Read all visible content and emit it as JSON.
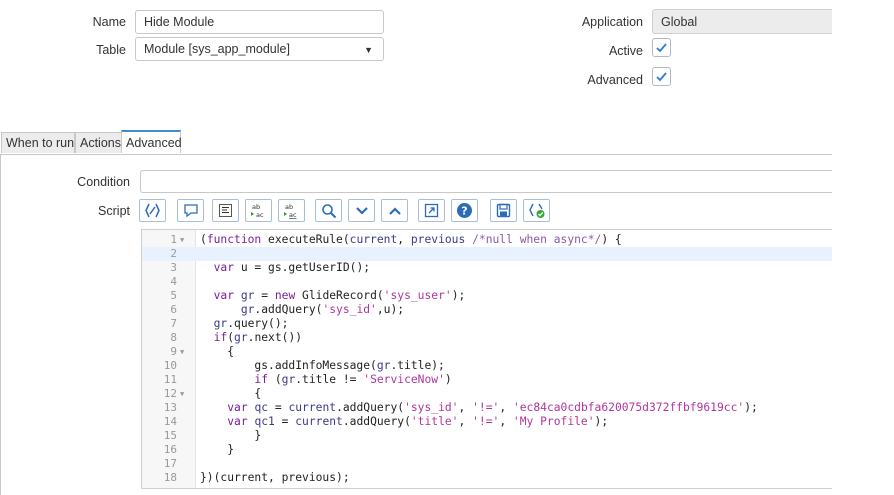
{
  "form": {
    "name_label": "Name",
    "name_value": "Hide Module",
    "table_label": "Table",
    "table_value": "Module [sys_app_module]",
    "application_label": "Application",
    "application_value": "Global",
    "active_label": "Active",
    "active_checked": true,
    "advanced_label": "Advanced",
    "advanced_checked": true
  },
  "tabs": [
    {
      "label": "When to run",
      "active": false
    },
    {
      "label": "Actions",
      "active": false
    },
    {
      "label": "Advanced",
      "active": true
    }
  ],
  "advanced": {
    "condition_label": "Condition",
    "condition_value": "",
    "script_label": "Script"
  },
  "toolbar": [
    {
      "icon": "script-tree-icon"
    },
    {
      "icon": "comment-icon"
    },
    {
      "icon": "format-code-icon"
    },
    {
      "icon": "replace-icon"
    },
    {
      "icon": "replace-all-icon"
    },
    {
      "icon": "search-icon"
    },
    {
      "icon": "collapse-icon"
    },
    {
      "icon": "expand-icon"
    },
    {
      "icon": "fullscreen-icon"
    },
    {
      "icon": "help-icon"
    },
    {
      "icon": "save-icon"
    },
    {
      "icon": "syntax-check-icon"
    }
  ],
  "colors": {
    "keyword": "#7a1e9a",
    "string": "#b0359f",
    "variable": "#3a3a8a",
    "comment": "#8a5aa8",
    "tab_accent": "#3a8fd8",
    "line_highlight": "#e8f2fe"
  },
  "script": {
    "lines": [
      {
        "n": "1",
        "fold": true,
        "tokens": [
          {
            "t": "(",
            "c": "p"
          },
          {
            "t": "function",
            "c": "k"
          },
          {
            "t": " executeRule(",
            "c": "p"
          },
          {
            "t": "current",
            "c": "v"
          },
          {
            "t": ", ",
            "c": "p"
          },
          {
            "t": "previous",
            "c": "v"
          },
          {
            "t": " /*null when async*/",
            "c": "c"
          },
          {
            "t": ") {",
            "c": "p"
          }
        ]
      },
      {
        "n": "2",
        "fold": false,
        "highlight": true,
        "tokens": []
      },
      {
        "n": "3",
        "fold": false,
        "tokens": [
          {
            "t": "  ",
            "c": "p"
          },
          {
            "t": "var",
            "c": "k"
          },
          {
            "t": " u = gs.getUserID();",
            "c": "p"
          }
        ]
      },
      {
        "n": "4",
        "fold": false,
        "tokens": []
      },
      {
        "n": "5",
        "fold": false,
        "tokens": [
          {
            "t": "  ",
            "c": "p"
          },
          {
            "t": "var",
            "c": "k"
          },
          {
            "t": " ",
            "c": "p"
          },
          {
            "t": "gr",
            "c": "v"
          },
          {
            "t": " = ",
            "c": "p"
          },
          {
            "t": "new",
            "c": "k"
          },
          {
            "t": " GlideRecord(",
            "c": "p"
          },
          {
            "t": "'sys_user'",
            "c": "s"
          },
          {
            "t": ");",
            "c": "p"
          }
        ]
      },
      {
        "n": "6",
        "fold": false,
        "tokens": [
          {
            "t": "      ",
            "c": "p"
          },
          {
            "t": "gr",
            "c": "v"
          },
          {
            "t": ".addQuery(",
            "c": "p"
          },
          {
            "t": "'sys_id'",
            "c": "s"
          },
          {
            "t": ",u);",
            "c": "p"
          }
        ]
      },
      {
        "n": "7",
        "fold": false,
        "tokens": [
          {
            "t": "  ",
            "c": "p"
          },
          {
            "t": "gr",
            "c": "v"
          },
          {
            "t": ".query();",
            "c": "p"
          }
        ]
      },
      {
        "n": "8",
        "fold": false,
        "tokens": [
          {
            "t": "  ",
            "c": "p"
          },
          {
            "t": "if",
            "c": "k"
          },
          {
            "t": "(",
            "c": "p"
          },
          {
            "t": "gr",
            "c": "v"
          },
          {
            "t": ".next())",
            "c": "p"
          }
        ]
      },
      {
        "n": "9",
        "fold": true,
        "tokens": [
          {
            "t": "    {",
            "c": "p"
          }
        ]
      },
      {
        "n": "10",
        "fold": false,
        "tokens": [
          {
            "t": "        gs.addInfoMessage(",
            "c": "p"
          },
          {
            "t": "gr",
            "c": "v"
          },
          {
            "t": ".title);",
            "c": "p"
          }
        ]
      },
      {
        "n": "11",
        "fold": false,
        "tokens": [
          {
            "t": "        ",
            "c": "p"
          },
          {
            "t": "if",
            "c": "k"
          },
          {
            "t": " (",
            "c": "p"
          },
          {
            "t": "gr",
            "c": "v"
          },
          {
            "t": ".title != ",
            "c": "p"
          },
          {
            "t": "'ServiceNow'",
            "c": "s"
          },
          {
            "t": ")",
            "c": "p"
          }
        ]
      },
      {
        "n": "12",
        "fold": true,
        "tokens": [
          {
            "t": "        {",
            "c": "p"
          }
        ]
      },
      {
        "n": "13",
        "fold": false,
        "tokens": [
          {
            "t": "    ",
            "c": "p"
          },
          {
            "t": "var",
            "c": "k"
          },
          {
            "t": " ",
            "c": "p"
          },
          {
            "t": "qc",
            "c": "v"
          },
          {
            "t": " = ",
            "c": "p"
          },
          {
            "t": "current",
            "c": "v"
          },
          {
            "t": ".addQuery(",
            "c": "p"
          },
          {
            "t": "'sys_id'",
            "c": "s"
          },
          {
            "t": ", ",
            "c": "p"
          },
          {
            "t": "'!='",
            "c": "s"
          },
          {
            "t": ", ",
            "c": "p"
          },
          {
            "t": "'ec84ca0cdbfa620075d372ffbf9619cc'",
            "c": "s"
          },
          {
            "t": ");",
            "c": "p"
          }
        ]
      },
      {
        "n": "14",
        "fold": false,
        "tokens": [
          {
            "t": "    ",
            "c": "p"
          },
          {
            "t": "var",
            "c": "k"
          },
          {
            "t": " ",
            "c": "p"
          },
          {
            "t": "qc1",
            "c": "v"
          },
          {
            "t": " = ",
            "c": "p"
          },
          {
            "t": "current",
            "c": "v"
          },
          {
            "t": ".addQuery(",
            "c": "p"
          },
          {
            "t": "'title'",
            "c": "s"
          },
          {
            "t": ", ",
            "c": "p"
          },
          {
            "t": "'!='",
            "c": "s"
          },
          {
            "t": ", ",
            "c": "p"
          },
          {
            "t": "'My Profile'",
            "c": "s"
          },
          {
            "t": ");",
            "c": "p"
          }
        ]
      },
      {
        "n": "15",
        "fold": false,
        "tokens": [
          {
            "t": "        }",
            "c": "p"
          }
        ]
      },
      {
        "n": "16",
        "fold": false,
        "tokens": [
          {
            "t": "    }",
            "c": "p"
          }
        ]
      },
      {
        "n": "17",
        "fold": false,
        "tokens": []
      },
      {
        "n": "18",
        "fold": false,
        "tokens": [
          {
            "t": "})(current, previous);",
            "c": "p"
          }
        ]
      }
    ]
  }
}
